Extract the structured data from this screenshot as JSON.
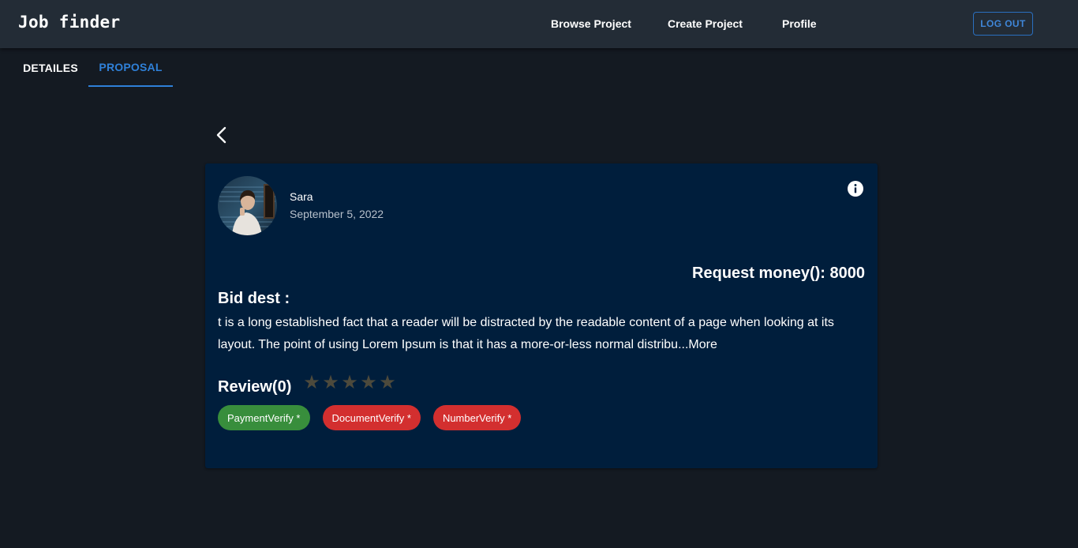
{
  "appbar": {
    "title": "Job finder",
    "nav": [
      {
        "label": "Browse Project"
      },
      {
        "label": "Create Project"
      },
      {
        "label": "Profile"
      }
    ],
    "logout_label": "LOG OUT"
  },
  "tabs": [
    {
      "label": "DETAILES",
      "active": false
    },
    {
      "label": "PROPOSAL",
      "active": true
    }
  ],
  "proposal": {
    "user": {
      "name": "Sara",
      "date": "September 5, 2022",
      "avatar_icon": "user-photo"
    },
    "request_money": "Request money(): 8000",
    "bid_heading": "Bid dest :",
    "bid_text": "t is a long established fact that a reader will be distracted by the readable content of a page when looking at its layout. The point of using Lorem Ipsum is that it has a more-or-less normal distribu...",
    "more_label": "More",
    "review_label": "Review(0)",
    "rating": 0,
    "rating_max": 5,
    "chips": [
      {
        "label": "PaymentVerify *",
        "status": "verified"
      },
      {
        "label": "DocumentVerify *",
        "status": "unverified"
      },
      {
        "label": "NumberVerify *",
        "status": "unverified"
      }
    ]
  },
  "colors": {
    "background": "#141a22",
    "appbar": "#232c36",
    "card": "#001e3c",
    "accent": "#2f80d8",
    "verified": "#388e3c",
    "unverified": "#d32f2f",
    "star_empty": "#4d4a3c"
  }
}
